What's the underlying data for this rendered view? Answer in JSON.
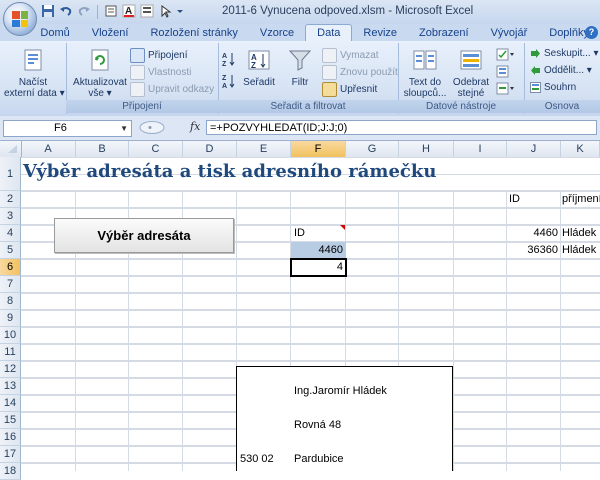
{
  "window": {
    "title": "2011-6 Vynucena odpoved.xlsm - Microsoft Excel"
  },
  "quick_access": {
    "icons": [
      "save-icon",
      "undo-icon",
      "redo-icon",
      "form-icon",
      "font-color-icon",
      "format-icon",
      "select-arrow-icon",
      "customize-qat-icon"
    ]
  },
  "ribbon": {
    "tabs": [
      "Domů",
      "Vložení",
      "Rozložení stránky",
      "Vzorce",
      "Data",
      "Revize",
      "Zobrazení",
      "Vývojář",
      "Doplňky"
    ],
    "active_tab": "Data",
    "groups": {
      "external": {
        "button_line1": "Načíst",
        "button_line2": "externí data ▾"
      },
      "connections": {
        "label": "Připojení",
        "refresh_line1": "Aktualizovat",
        "refresh_line2": "vše ▾",
        "connections_btn": "Připojení",
        "properties_btn": "Vlastnosti",
        "edit_links_btn": "Upravit odkazy"
      },
      "sort_filter": {
        "label": "Seřadit a filtrovat",
        "sort_btn": "Seřadit",
        "filter_btn": "Filtr",
        "clear_btn": "Vymazat",
        "reapply_btn": "Znovu použít",
        "advanced_btn": "Upřesnit"
      },
      "data_tools": {
        "label": "Datové nástroje",
        "text_to_columns_line1": "Text do",
        "text_to_columns_line2": "sloupců...",
        "remove_dup_line1": "Odebrat",
        "remove_dup_line2": "stejné"
      },
      "outline": {
        "label": "Osnova",
        "group_btn": "Seskupit... ▾",
        "ungroup_btn": "Oddělit... ▾",
        "subtotal_btn": "Souhrn"
      }
    }
  },
  "formula_bar": {
    "name_box": "F6",
    "fx": "fx",
    "formula": "=+POZVYHLEDAT(ID;J:J;0)"
  },
  "columns": [
    "A",
    "B",
    "C",
    "D",
    "E",
    "F",
    "G",
    "H",
    "I",
    "J",
    "K"
  ],
  "selected_column": "F",
  "rows": [
    "1",
    "2",
    "3",
    "4",
    "5",
    "6",
    "7",
    "8",
    "9",
    "10",
    "11",
    "12",
    "13",
    "14",
    "15",
    "16",
    "17",
    "18"
  ],
  "selected_row": "6",
  "sheet": {
    "title": "Výběr adresáta a tisk adresního rámečku",
    "macro_button": "Výběr adresáta",
    "f4": "ID",
    "f5": "4460",
    "f6": "4",
    "j3": "ID",
    "k3": "příjmení",
    "j4": "4460",
    "k4": "Hládek",
    "j5": "36360",
    "k5": "Hládek",
    "f14": "Ing.Jaromír Hládek",
    "f16": "Rovná 48",
    "e18": "530 02",
    "f18": "Pardubice"
  },
  "colors": {
    "title_text": "#1f497d",
    "selected_header": "#f1c15f",
    "input_highlight": "#b8cce4",
    "comment_marker": "#d40000"
  }
}
